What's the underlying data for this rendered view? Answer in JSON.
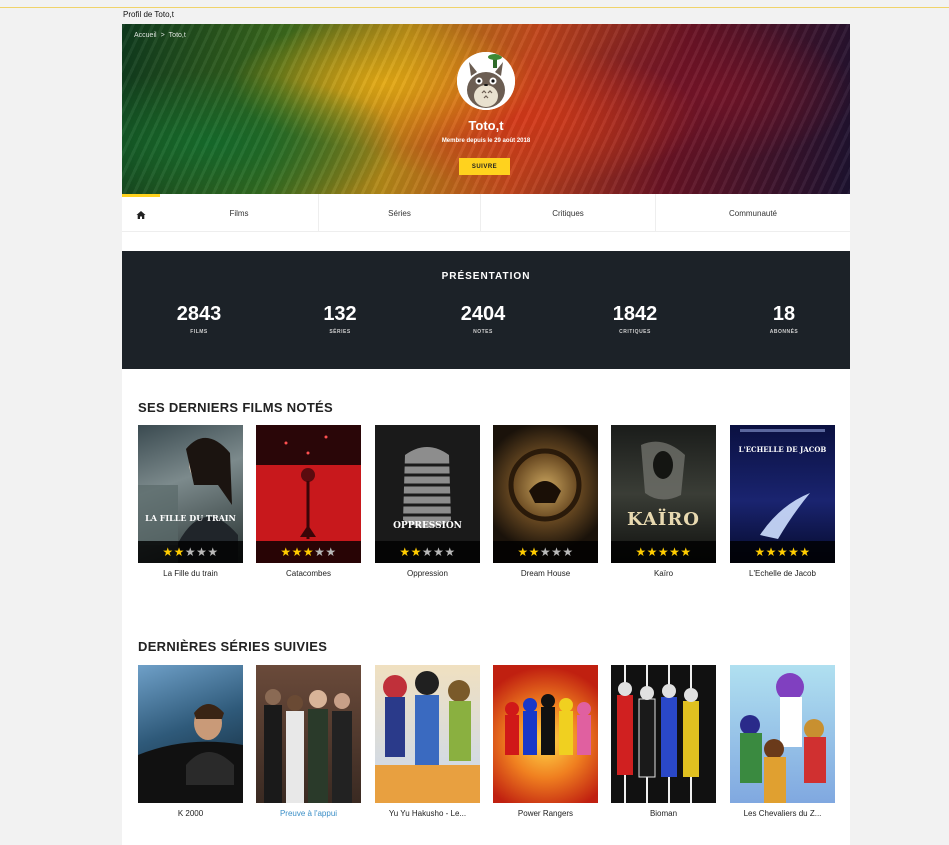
{
  "page": {
    "title": "Profil de Toto,t"
  },
  "colors": {
    "accent": "#ffd21e",
    "presentation_bg": "#1c2228",
    "link": "#3b8fc7"
  },
  "header": {
    "breadcrumb": [
      "Accueil",
      ">",
      "Toto,t"
    ],
    "username": "Toto,t",
    "member_since": "Membre depuis le 29 août 2018",
    "follow_label": "SUIVRE",
    "avatar_icon": "totoro-avatar"
  },
  "nav": {
    "home_icon": "home-icon",
    "items": [
      {
        "label": "Films"
      },
      {
        "label": "Séries"
      },
      {
        "label": "Critiques"
      },
      {
        "label": "Communauté"
      }
    ]
  },
  "presentation": {
    "title": "PRÉSENTATION",
    "stats": [
      {
        "value": "2843",
        "label": "FILMS"
      },
      {
        "value": "132",
        "label": "SÉRIES"
      },
      {
        "value": "2404",
        "label": "NOTES"
      },
      {
        "value": "1842",
        "label": "CRITIQUES"
      },
      {
        "value": "18",
        "label": "ABONNÉS"
      }
    ]
  },
  "films": {
    "title": "SES DERNIERS FILMS NOTÉS",
    "items": [
      {
        "title": "La Fille du train",
        "rating": 2,
        "poster_caption": "LA FILLE DU TRAIN"
      },
      {
        "title": "Catacombes",
        "rating": 3,
        "poster_caption": ""
      },
      {
        "title": "Oppression",
        "rating": 2,
        "poster_caption": "OPPRESSION"
      },
      {
        "title": "Dream House",
        "rating": 2,
        "poster_caption": ""
      },
      {
        "title": "Kaïro",
        "rating": 5,
        "poster_caption": "KAÏRO"
      },
      {
        "title": "L'Echelle de Jacob",
        "rating": 5,
        "poster_caption": "L'ECHELLE DE JACOB"
      }
    ]
  },
  "series": {
    "title": "DERNIÈRES SÉRIES SUIVIES",
    "items": [
      {
        "title": "K 2000"
      },
      {
        "title": "Preuve à l'appui"
      },
      {
        "title": "Yu Yu Hakusho - Le..."
      },
      {
        "title": "Power Rangers"
      },
      {
        "title": "Bioman"
      },
      {
        "title": "Les Chevaliers du Z..."
      }
    ]
  }
}
